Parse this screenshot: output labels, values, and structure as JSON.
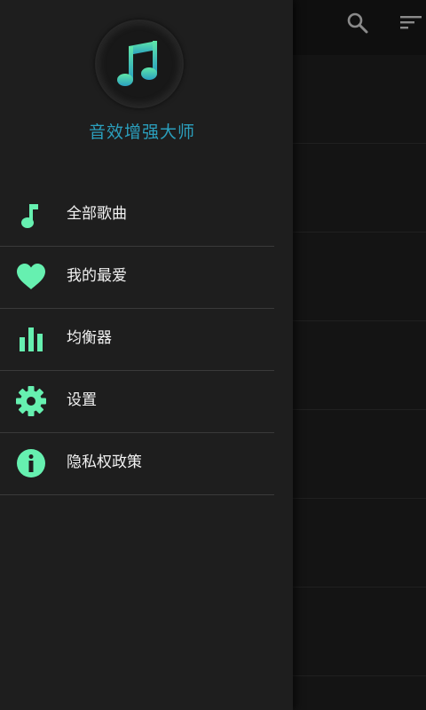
{
  "app": {
    "title": "音效增强大师",
    "accent": "#2b9fbd",
    "icon_color": "#66f0b0"
  },
  "toolbar": {
    "icons": [
      "search-icon",
      "sort-icon"
    ]
  },
  "menu": {
    "items": [
      {
        "label": "全部歌曲",
        "icon": "music-note-icon"
      },
      {
        "label": "我的最爱",
        "icon": "heart-icon"
      },
      {
        "label": "均衡器",
        "icon": "equalizer-icon"
      },
      {
        "label": "设置",
        "icon": "gear-icon"
      },
      {
        "label": "隐私权政策",
        "icon": "info-icon"
      }
    ]
  }
}
